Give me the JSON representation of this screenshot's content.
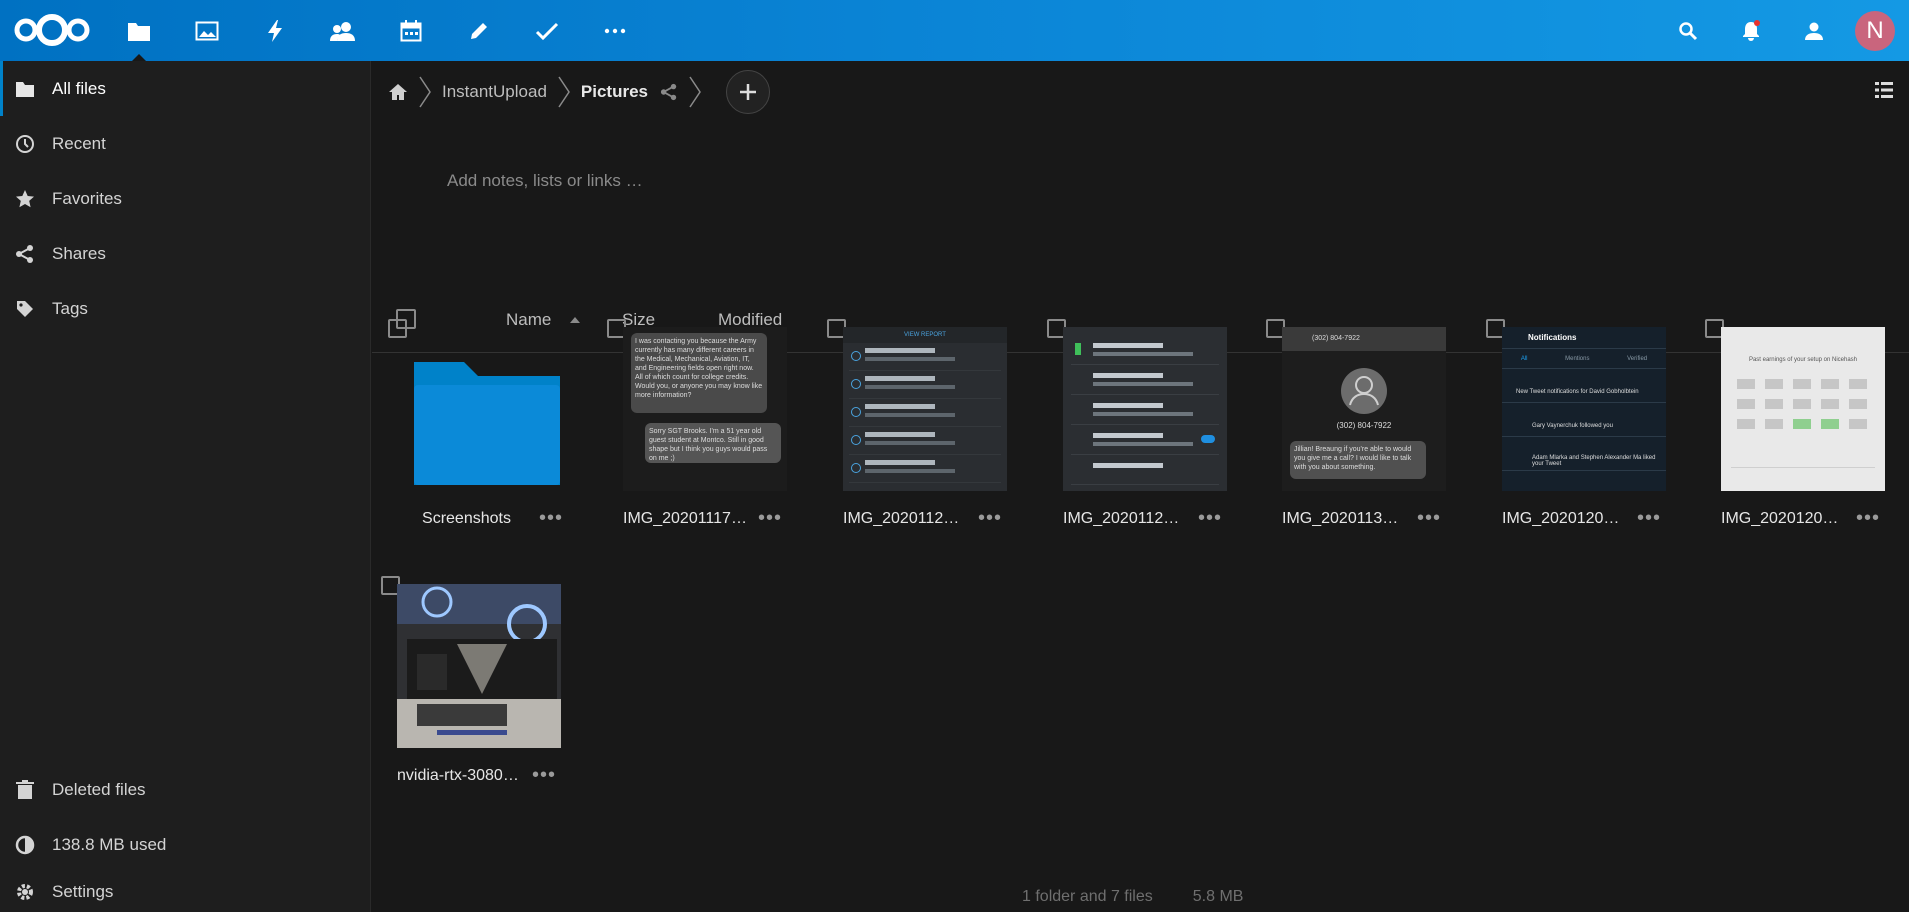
{
  "header": {
    "apps": [
      {
        "name": "files",
        "icon": "folder-icon",
        "active": true
      },
      {
        "name": "photos",
        "icon": "image-icon"
      },
      {
        "name": "activity",
        "icon": "lightning-icon"
      },
      {
        "name": "contacts",
        "icon": "contacts-icon"
      },
      {
        "name": "calendar",
        "icon": "calendar-icon"
      },
      {
        "name": "notes",
        "icon": "pencil-icon"
      },
      {
        "name": "tasks",
        "icon": "checkmark-icon"
      },
      {
        "name": "more-apps",
        "icon": "more-icon"
      }
    ],
    "avatar_initial": "N",
    "accent_color": "#0082c9"
  },
  "sidebar": {
    "items": [
      {
        "label": "All files",
        "icon": "folder-icon"
      },
      {
        "label": "Recent",
        "icon": "clock-icon"
      },
      {
        "label": "Favorites",
        "icon": "star-icon"
      },
      {
        "label": "Shares",
        "icon": "share-icon"
      },
      {
        "label": "Tags",
        "icon": "tag-icon"
      }
    ],
    "bottom": [
      {
        "label": "Deleted files",
        "icon": "trash-icon"
      },
      {
        "label": "138.8 MB used",
        "icon": "quota-icon"
      },
      {
        "label": "Settings",
        "icon": "gear-icon"
      }
    ]
  },
  "breadcrumb": {
    "items": [
      "InstantUpload",
      "Pictures"
    ]
  },
  "notes": {
    "placeholder": "Add notes, lists or links …"
  },
  "columns": {
    "name": "Name",
    "size": "Size",
    "modified": "Modified"
  },
  "files": [
    {
      "name": "Screenshots",
      "type": "folder"
    },
    {
      "name": "IMG_20201117_…",
      "type": "image"
    },
    {
      "name": "IMG_20201124_…",
      "type": "image"
    },
    {
      "name": "IMG_20201125_…",
      "type": "image"
    },
    {
      "name": "IMG_20201130_…",
      "type": "image"
    },
    {
      "name": "IMG_20201204_…",
      "type": "image"
    },
    {
      "name": "IMG_20201208_…",
      "type": "image"
    },
    {
      "name": "nvidia-rtx-3080…",
      "type": "image"
    }
  ],
  "thumbs": {
    "chat1": "I was contacting you because the Army currently has many different careers in the Medical, Mechanical, Aviation, IT, and Engineering fields open right now. All of which count for college credits. Would you, or anyone you may know like more information?",
    "chat2": "Sorry SGT Brooks. I'm a 51 year old guest student at Montco. Still in good shape but I think you guys would pass on me ;)",
    "list_header": "VIEW REPORT",
    "list_rows": [
      "AppsFlyer",
      "Facebook Login",
      "Facebook Share",
      "Google Analytics",
      "Google Firebase Analytics"
    ],
    "settings_rows": [
      "Apps are running normally",
      "Battery Saver",
      "Battery Manager",
      "Battery percentage",
      "Last full charge"
    ],
    "settings_last": "18 hours ago",
    "phone_number": "(302) 804-7922",
    "phone_msg": "Jillian! Breaung if you're able to would you give me a call? I would like to talk with you about something.",
    "notif_title": "Notifications",
    "notif_tabs": [
      "All",
      "Mentions",
      "Verified"
    ],
    "notif_rows": [
      "New Tweet notifications for David Gobholbtein",
      "Gary Vaynerchuk followed you",
      "Adam Mlarka and Stephen Alexander Ma liked your Tweet"
    ],
    "light_title": "Past earnings of your setup on Ni­cehash"
  },
  "footer": {
    "summary": "1 folder and 7 files",
    "total_size": "5.8 MB"
  }
}
